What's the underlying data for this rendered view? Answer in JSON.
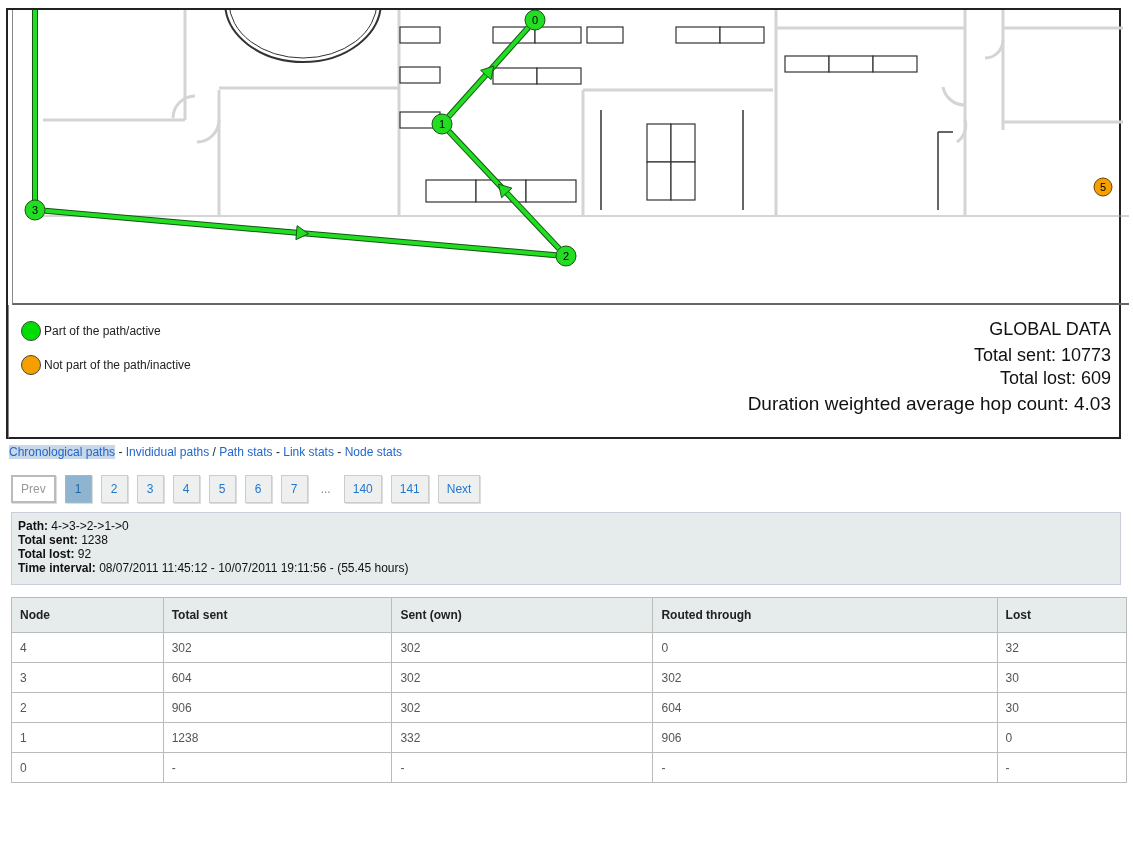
{
  "map": {
    "nodes": [
      {
        "label": "0",
        "active": true
      },
      {
        "label": "1",
        "active": true
      },
      {
        "label": "2",
        "active": true
      },
      {
        "label": "3",
        "active": true
      },
      {
        "label": "5",
        "active": false
      }
    ]
  },
  "legend": [
    {
      "label": "Part of the path/active",
      "color": "#00dd00"
    },
    {
      "label": "Not part of the path/inactive",
      "color": "#f5a000"
    }
  ],
  "global_data": {
    "title": "GLOBAL DATA",
    "lines": [
      "Total sent: 10773",
      "Total lost: 609",
      "Duration weighted average hop count: 4.03"
    ]
  },
  "nav_links": [
    {
      "label": "Chronological paths",
      "selected": true,
      "separator": "-"
    },
    {
      "label": "Invididual paths",
      "selected": false,
      "separator": "/"
    },
    {
      "label": "Path stats",
      "selected": false,
      "separator": "-"
    },
    {
      "label": "Link stats",
      "selected": false,
      "separator": "-"
    },
    {
      "label": "Node stats",
      "selected": false
    }
  ],
  "pagination": [
    {
      "kind": "nav",
      "label": "Prev",
      "disabled": true
    },
    {
      "kind": "page",
      "label": "1",
      "selected": true
    },
    {
      "kind": "page",
      "label": "2",
      "selected": false
    },
    {
      "kind": "page",
      "label": "3",
      "selected": false
    },
    {
      "kind": "page",
      "label": "4",
      "selected": false
    },
    {
      "kind": "page",
      "label": "5",
      "selected": false
    },
    {
      "kind": "page",
      "label": "6",
      "selected": false
    },
    {
      "kind": "page",
      "label": "7",
      "selected": false
    },
    {
      "kind": "ellipsis",
      "label": "..."
    },
    {
      "kind": "page",
      "label": "140",
      "selected": false
    },
    {
      "kind": "page",
      "label": "141",
      "selected": false
    },
    {
      "kind": "nav",
      "label": "Next",
      "disabled": false
    }
  ],
  "path_info": [
    {
      "label": "Path:",
      "value": "4->3->2->1->0"
    },
    {
      "label": "Total sent:",
      "value": "1238"
    },
    {
      "label": "Total lost:",
      "value": "92"
    },
    {
      "label": "Time interval:",
      "value": "08/07/2011 11:45:12 - 10/07/2011 19:11:56 - (55.45 hours)"
    }
  ],
  "table": {
    "columns": [
      "Node",
      "Total sent",
      "Sent (own)",
      "Routed through",
      "Lost"
    ],
    "rows": [
      [
        "4",
        "302",
        "302",
        "0",
        "32"
      ],
      [
        "3",
        "604",
        "302",
        "302",
        "30"
      ],
      [
        "2",
        "906",
        "302",
        "604",
        "30"
      ],
      [
        "1",
        "1238",
        "332",
        "906",
        "0"
      ],
      [
        "0",
        "-",
        "-",
        "-",
        "-"
      ]
    ]
  }
}
